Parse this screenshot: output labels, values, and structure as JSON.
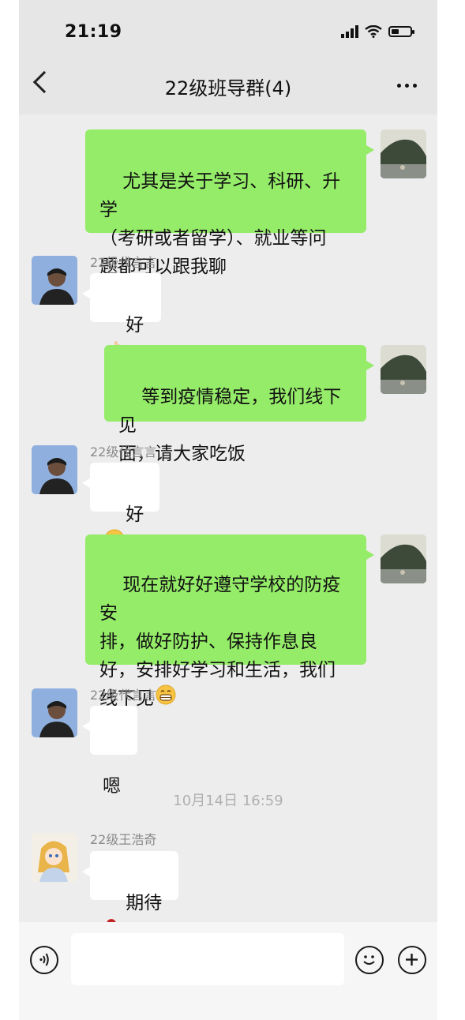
{
  "status_bar": {
    "time": "21:19"
  },
  "header": {
    "title": "22级班导群(4)"
  },
  "messages": [
    {
      "direction": "out",
      "text": "尤其是关于学习、科研、升学\n（考研或者留学）、就业等问\n题都可以跟我聊"
    },
    {
      "direction": "in",
      "sender": "22级代言言",
      "text": "好",
      "emoji": "ok-hand-emoji"
    },
    {
      "direction": "out",
      "text": "等到疫情稳定，我们线下见\n面，请大家吃饭"
    },
    {
      "direction": "in",
      "sender": "22级代言言",
      "text": "好",
      "emoji": "smile-emoji"
    },
    {
      "direction": "out",
      "text": "现在就好好遵守学校的防疫安\n排，做好防护、保持作息良\n好，安排好学习和生活，我们\n线下见",
      "emoji": "grin-emoji"
    },
    {
      "direction": "in",
      "sender": "22级代言言",
      "text": "嗯"
    },
    {
      "direction": "in",
      "sender": "22级王浩奇",
      "text": "期待",
      "emoji": "rose-emoji"
    }
  ],
  "timestamp": "10月14日 16:59",
  "input_bar": {
    "icons": [
      "voice-icon",
      "emoji-icon",
      "plus-icon"
    ]
  },
  "colors": {
    "outgoing_bubble": "#95ec69",
    "incoming_bubble": "#ffffff",
    "background": "#ededed"
  }
}
